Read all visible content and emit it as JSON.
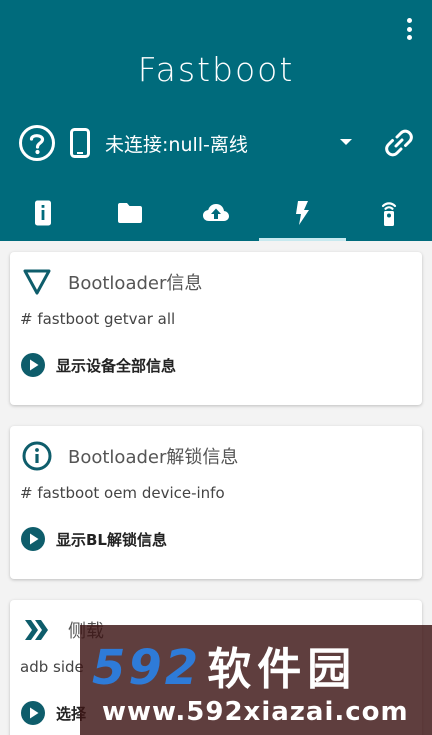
{
  "app": {
    "title": "Fastboot"
  },
  "colors": {
    "primary": "#006b7c",
    "accent_icon": "#0e5d6b",
    "background": "#f3f3f3"
  },
  "device": {
    "status_text": "未连接:null-离线"
  },
  "icons": {
    "menu": "more-vert-icon",
    "help": "help-circle-icon",
    "device": "phone-icon",
    "dropdown": "arrow-drop-down-icon",
    "link": "link-off-icon"
  },
  "tabs": [
    {
      "icon": "phone-info-icon",
      "active": false
    },
    {
      "icon": "folder-icon",
      "active": false
    },
    {
      "icon": "cloud-upload-icon",
      "active": false
    },
    {
      "icon": "flash-icon",
      "active": true
    },
    {
      "icon": "remote-icon",
      "active": false
    }
  ],
  "cards": [
    {
      "icon": "triangle-down-icon",
      "title": "Bootloader信息",
      "command": "# fastboot getvar all",
      "action": "显示设备全部信息"
    },
    {
      "icon": "info-circle-icon",
      "title": "Bootloader解锁信息",
      "command": "# fastboot oem device-info",
      "action": "显示BL解锁信息"
    },
    {
      "icon": "double-chevron-icon",
      "title": "侧载",
      "command": "adb side",
      "action": "选择"
    }
  ],
  "watermark": {
    "brand_number": "592",
    "brand_cn": "软件园",
    "url": "www.592xiazai.com"
  }
}
